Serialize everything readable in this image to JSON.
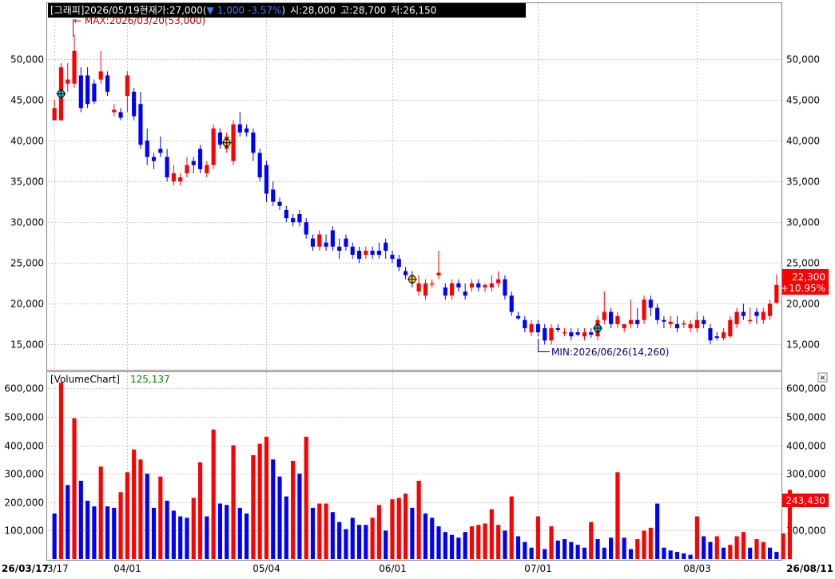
{
  "header": {
    "symbol_label": "[그래피]",
    "date": "2026/05/19",
    "current_label": "현재가:",
    "current_value": "27,000",
    "change_arrow": "▼",
    "change_text": "1,000 -3.57%",
    "open_label": "시:",
    "open_value": "28,000",
    "high_label": "고:",
    "high_value": "28,700",
    "low_label": "저:",
    "low_value": "26,150"
  },
  "annotations": {
    "max_text": "← MAX:2026/03/20(53,000)",
    "min_text": "MIN:2026/06/26(14,260)"
  },
  "price_badge": {
    "value": "22,300",
    "change": "+10.95%"
  },
  "volume_panel": {
    "title": "[VolumeChart]",
    "value": "125,137",
    "badge": "243,430",
    "close_symbol": "×"
  },
  "date_axis": {
    "left_end": "26/03/17",
    "right_end": "26/08/11"
  },
  "colors": {
    "up": "#ff0000",
    "down": "#0000ff",
    "header_bg": "#000000",
    "header_fg": "#ffffff",
    "min_max_text": "#000080",
    "max_text": "#c00000",
    "volume_value_text": "#008000",
    "grid": "#c8c8c8"
  },
  "chart_data": [
    {
      "type": "candlestick",
      "ylim": [
        12000,
        55000
      ],
      "y_ticks": [
        15000,
        20000,
        25000,
        30000,
        35000,
        40000,
        45000,
        50000
      ],
      "y_tick_labels": [
        "15,000",
        "20,000",
        "25,000",
        "30,000",
        "35,000",
        "40,000",
        "45,000",
        "50,000"
      ],
      "x_tick_labels": [
        {
          "index": 0,
          "label": "03/17"
        },
        {
          "index": 11,
          "label": "04/01"
        },
        {
          "index": 32,
          "label": "05/04"
        },
        {
          "index": 51,
          "label": "06/01"
        },
        {
          "index": 73,
          "label": "07/01"
        },
        {
          "index": 97,
          "label": "08/03"
        }
      ],
      "candles": [
        {
          "o": 42500,
          "h": 45000,
          "l": 42500,
          "c": 44000
        },
        {
          "o": 42500,
          "h": 49500,
          "l": 42500,
          "c": 49000
        },
        {
          "o": 47000,
          "h": 49500,
          "l": 46000,
          "c": 47500
        },
        {
          "o": 47000,
          "h": 53000,
          "l": 46500,
          "c": 51000
        },
        {
          "o": 48000,
          "h": 49000,
          "l": 43500,
          "c": 44000
        },
        {
          "o": 48000,
          "h": 49000,
          "l": 44000,
          "c": 44500
        },
        {
          "o": 47000,
          "h": 47500,
          "l": 44500,
          "c": 44800
        },
        {
          "o": 47500,
          "h": 51000,
          "l": 47000,
          "c": 48500
        },
        {
          "o": 48000,
          "h": 48500,
          "l": 45500,
          "c": 46000
        },
        {
          "o": 43500,
          "h": 44500,
          "l": 43000,
          "c": 43800
        },
        {
          "o": 43500,
          "h": 44000,
          "l": 42500,
          "c": 42800
        },
        {
          "o": 45500,
          "h": 48500,
          "l": 43500,
          "c": 48000
        },
        {
          "o": 46000,
          "h": 46500,
          "l": 42500,
          "c": 43000
        },
        {
          "o": 44500,
          "h": 46000,
          "l": 39000,
          "c": 39500
        },
        {
          "o": 40000,
          "h": 41500,
          "l": 37000,
          "c": 38000
        },
        {
          "o": 38000,
          "h": 38500,
          "l": 36500,
          "c": 37500
        },
        {
          "o": 39000,
          "h": 40500,
          "l": 38000,
          "c": 38500
        },
        {
          "o": 38000,
          "h": 39000,
          "l": 35000,
          "c": 35500
        },
        {
          "o": 35000,
          "h": 37000,
          "l": 34500,
          "c": 36000
        },
        {
          "o": 35000,
          "h": 36000,
          "l": 34500,
          "c": 35500
        },
        {
          "o": 36000,
          "h": 38000,
          "l": 35500,
          "c": 37000
        },
        {
          "o": 37500,
          "h": 38000,
          "l": 36000,
          "c": 37000
        },
        {
          "o": 39000,
          "h": 39500,
          "l": 36000,
          "c": 36500
        },
        {
          "o": 36000,
          "h": 37500,
          "l": 35500,
          "c": 37000
        },
        {
          "o": 37000,
          "h": 42000,
          "l": 36500,
          "c": 41500
        },
        {
          "o": 41000,
          "h": 41500,
          "l": 39000,
          "c": 39500
        },
        {
          "o": 39000,
          "h": 41000,
          "l": 38500,
          "c": 40500
        },
        {
          "o": 37500,
          "h": 42500,
          "l": 37000,
          "c": 42000
        },
        {
          "o": 42000,
          "h": 43500,
          "l": 40500,
          "c": 41000
        },
        {
          "o": 41500,
          "h": 42000,
          "l": 40500,
          "c": 41000
        },
        {
          "o": 41000,
          "h": 41500,
          "l": 37500,
          "c": 38500
        },
        {
          "o": 38500,
          "h": 39000,
          "l": 35000,
          "c": 35500
        },
        {
          "o": 37000,
          "h": 37500,
          "l": 32500,
          "c": 33500
        },
        {
          "o": 34000,
          "h": 35000,
          "l": 32000,
          "c": 32500
        },
        {
          "o": 32500,
          "h": 33000,
          "l": 31500,
          "c": 32000
        },
        {
          "o": 31500,
          "h": 32000,
          "l": 30000,
          "c": 30500
        },
        {
          "o": 30500,
          "h": 31000,
          "l": 29500,
          "c": 30000
        },
        {
          "o": 31000,
          "h": 31500,
          "l": 29500,
          "c": 30000
        },
        {
          "o": 30000,
          "h": 30500,
          "l": 28000,
          "c": 28500
        },
        {
          "o": 28000,
          "h": 28500,
          "l": 26500,
          "c": 27000
        },
        {
          "o": 27000,
          "h": 29000,
          "l": 26500,
          "c": 28500
        },
        {
          "o": 27500,
          "h": 28500,
          "l": 26500,
          "c": 27000
        },
        {
          "o": 29000,
          "h": 29500,
          "l": 26500,
          "c": 27000
        },
        {
          "o": 27000,
          "h": 28000,
          "l": 25500,
          "c": 26500
        },
        {
          "o": 28000,
          "h": 28500,
          "l": 26500,
          "c": 27000
        },
        {
          "o": 27000,
          "h": 27500,
          "l": 25500,
          "c": 26000
        },
        {
          "o": 26500,
          "h": 27000,
          "l": 25000,
          "c": 25500
        },
        {
          "o": 26000,
          "h": 27000,
          "l": 25500,
          "c": 26500
        },
        {
          "o": 26500,
          "h": 27000,
          "l": 25500,
          "c": 26000
        },
        {
          "o": 26500,
          "h": 27500,
          "l": 25500,
          "c": 26000
        },
        {
          "o": 27500,
          "h": 28000,
          "l": 25500,
          "c": 26500
        },
        {
          "o": 26000,
          "h": 26500,
          "l": 25000,
          "c": 25500
        },
        {
          "o": 25500,
          "h": 26000,
          "l": 24000,
          "c": 24500
        },
        {
          "o": 24000,
          "h": 24500,
          "l": 23000,
          "c": 23500
        },
        {
          "o": 23500,
          "h": 24000,
          "l": 22000,
          "c": 22500
        },
        {
          "o": 21500,
          "h": 23500,
          "l": 21000,
          "c": 22500
        },
        {
          "o": 21000,
          "h": 23000,
          "l": 20500,
          "c": 22500
        },
        {
          "o": 22500,
          "h": 23000,
          "l": 22000,
          "c": 22500
        },
        {
          "o": 23500,
          "h": 26500,
          "l": 23000,
          "c": 23800
        },
        {
          "o": 22000,
          "h": 22500,
          "l": 20500,
          "c": 21000
        },
        {
          "o": 21000,
          "h": 23000,
          "l": 20500,
          "c": 22500
        },
        {
          "o": 22500,
          "h": 23000,
          "l": 21500,
          "c": 22000
        },
        {
          "o": 21500,
          "h": 22500,
          "l": 20500,
          "c": 21000
        },
        {
          "o": 22000,
          "h": 23000,
          "l": 21500,
          "c": 22500
        },
        {
          "o": 22500,
          "h": 23000,
          "l": 21500,
          "c": 22000
        },
        {
          "o": 22000,
          "h": 22500,
          "l": 21500,
          "c": 22300
        },
        {
          "o": 22000,
          "h": 23500,
          "l": 21500,
          "c": 22500
        },
        {
          "o": 22500,
          "h": 24000,
          "l": 22000,
          "c": 23000
        },
        {
          "o": 23000,
          "h": 23500,
          "l": 20500,
          "c": 21000
        },
        {
          "o": 21000,
          "h": 21500,
          "l": 18500,
          "c": 19000
        },
        {
          "o": 18500,
          "h": 19000,
          "l": 18000,
          "c": 18200
        },
        {
          "o": 18000,
          "h": 18500,
          "l": 16500,
          "c": 17000
        },
        {
          "o": 16500,
          "h": 18000,
          "l": 16000,
          "c": 17500
        },
        {
          "o": 17500,
          "h": 18000,
          "l": 16000,
          "c": 16500
        },
        {
          "o": 17000,
          "h": 17500,
          "l": 15000,
          "c": 15500
        },
        {
          "o": 15500,
          "h": 17500,
          "l": 15000,
          "c": 17000
        },
        {
          "o": 17000,
          "h": 17500,
          "l": 16500,
          "c": 16800
        },
        {
          "o": 16500,
          "h": 17000,
          "l": 16000,
          "c": 16500
        },
        {
          "o": 16500,
          "h": 17000,
          "l": 15500,
          "c": 16000
        },
        {
          "o": 16500,
          "h": 17000,
          "l": 16000,
          "c": 16200
        },
        {
          "o": 16000,
          "h": 17000,
          "l": 15500,
          "c": 16500
        },
        {
          "o": 16500,
          "h": 17000,
          "l": 15800,
          "c": 16200
        },
        {
          "o": 16000,
          "h": 18500,
          "l": 15500,
          "c": 18000
        },
        {
          "o": 18000,
          "h": 21500,
          "l": 17500,
          "c": 19000
        },
        {
          "o": 19000,
          "h": 19500,
          "l": 17000,
          "c": 17500
        },
        {
          "o": 17500,
          "h": 19000,
          "l": 17000,
          "c": 18500
        },
        {
          "o": 17000,
          "h": 17500,
          "l": 16500,
          "c": 17500
        },
        {
          "o": 17500,
          "h": 20500,
          "l": 17000,
          "c": 18000
        },
        {
          "o": 18000,
          "h": 19500,
          "l": 17000,
          "c": 17500
        },
        {
          "o": 18000,
          "h": 21000,
          "l": 17500,
          "c": 20500
        },
        {
          "o": 20500,
          "h": 21000,
          "l": 18500,
          "c": 19500
        },
        {
          "o": 19500,
          "h": 20000,
          "l": 17500,
          "c": 18000
        },
        {
          "o": 18000,
          "h": 18500,
          "l": 17000,
          "c": 17800
        },
        {
          "o": 17500,
          "h": 18500,
          "l": 17000,
          "c": 17800
        },
        {
          "o": 17500,
          "h": 18500,
          "l": 16500,
          "c": 17000
        },
        {
          "o": 17500,
          "h": 18000,
          "l": 17000,
          "c": 17600
        },
        {
          "o": 17000,
          "h": 18000,
          "l": 16500,
          "c": 17500
        },
        {
          "o": 17000,
          "h": 19000,
          "l": 16500,
          "c": 18000
        },
        {
          "o": 18000,
          "h": 18500,
          "l": 17000,
          "c": 17500
        },
        {
          "o": 17000,
          "h": 17500,
          "l": 15000,
          "c": 15500
        },
        {
          "o": 16000,
          "h": 16500,
          "l": 15500,
          "c": 15800
        },
        {
          "o": 15800,
          "h": 17000,
          "l": 15500,
          "c": 16500
        },
        {
          "o": 16000,
          "h": 18500,
          "l": 15800,
          "c": 18000
        },
        {
          "o": 17500,
          "h": 19500,
          "l": 17000,
          "c": 19000
        },
        {
          "o": 19000,
          "h": 20000,
          "l": 18000,
          "c": 18500
        },
        {
          "o": 18000,
          "h": 19500,
          "l": 17500,
          "c": 18000
        },
        {
          "o": 19000,
          "h": 19500,
          "l": 17500,
          "c": 18500
        },
        {
          "o": 18000,
          "h": 19500,
          "l": 17500,
          "c": 19000
        },
        {
          "o": 18500,
          "h": 20500,
          "l": 18000,
          "c": 20000
        },
        {
          "o": 20100,
          "h": 23600,
          "l": 20000,
          "c": 22300
        }
      ]
    },
    {
      "type": "bar",
      "ylim": [
        0,
        640000
      ],
      "y_ticks": [
        100000,
        200000,
        300000,
        400000,
        500000,
        600000
      ],
      "y_tick_labels": [
        "100,000",
        "200,000",
        "300,000",
        "400,000",
        "500,000",
        "600,000"
      ],
      "values": [
        160000,
        620000,
        260000,
        495000,
        275000,
        205000,
        185000,
        325000,
        185000,
        180000,
        235000,
        305000,
        385000,
        350000,
        300000,
        180000,
        290000,
        205000,
        170000,
        150000,
        145000,
        215000,
        340000,
        150000,
        455000,
        195000,
        190000,
        400000,
        180000,
        160000,
        365000,
        405000,
        430000,
        350000,
        290000,
        220000,
        345000,
        300000,
        430000,
        180000,
        195000,
        195000,
        165000,
        130000,
        105000,
        145000,
        120000,
        120000,
        145000,
        190000,
        100000,
        210000,
        215000,
        230000,
        180000,
        275000,
        160000,
        145000,
        115000,
        95000,
        85000,
        75000,
        95000,
        115000,
        120000,
        125000,
        175000,
        120000,
        100000,
        220000,
        80000,
        60000,
        40000,
        150000,
        35000,
        115000,
        65000,
        70000,
        60000,
        50000,
        40000,
        130000,
        70000,
        40000,
        75000,
        305000,
        75000,
        35000,
        70000,
        100000,
        110000,
        195000,
        40000,
        30000,
        25000,
        20000,
        15000,
        150000,
        80000,
        60000,
        80000,
        40000,
        50000,
        80000,
        95000,
        40000,
        70000,
        60000,
        40000,
        25000,
        90000,
        243430
      ],
      "up": [
        false,
        true,
        false,
        true,
        false,
        false,
        false,
        true,
        false,
        false,
        true,
        true,
        true,
        true,
        false,
        false,
        true,
        false,
        false,
        false,
        false,
        true,
        true,
        false,
        true,
        false,
        false,
        true,
        false,
        false,
        true,
        true,
        true,
        false,
        false,
        false,
        true,
        false,
        true,
        false,
        true,
        true,
        false,
        false,
        false,
        false,
        false,
        false,
        true,
        true,
        false,
        true,
        true,
        true,
        false,
        true,
        false,
        false,
        false,
        false,
        false,
        false,
        false,
        true,
        true,
        true,
        true,
        true,
        false,
        true,
        false,
        false,
        false,
        true,
        false,
        true,
        false,
        false,
        false,
        false,
        false,
        true,
        false,
        false,
        false,
        true,
        false,
        false,
        true,
        true,
        true,
        false,
        false,
        false,
        false,
        false,
        false,
        true,
        false,
        false,
        true,
        false,
        true,
        true,
        true,
        false,
        true,
        true,
        false,
        false,
        true,
        true
      ]
    }
  ]
}
